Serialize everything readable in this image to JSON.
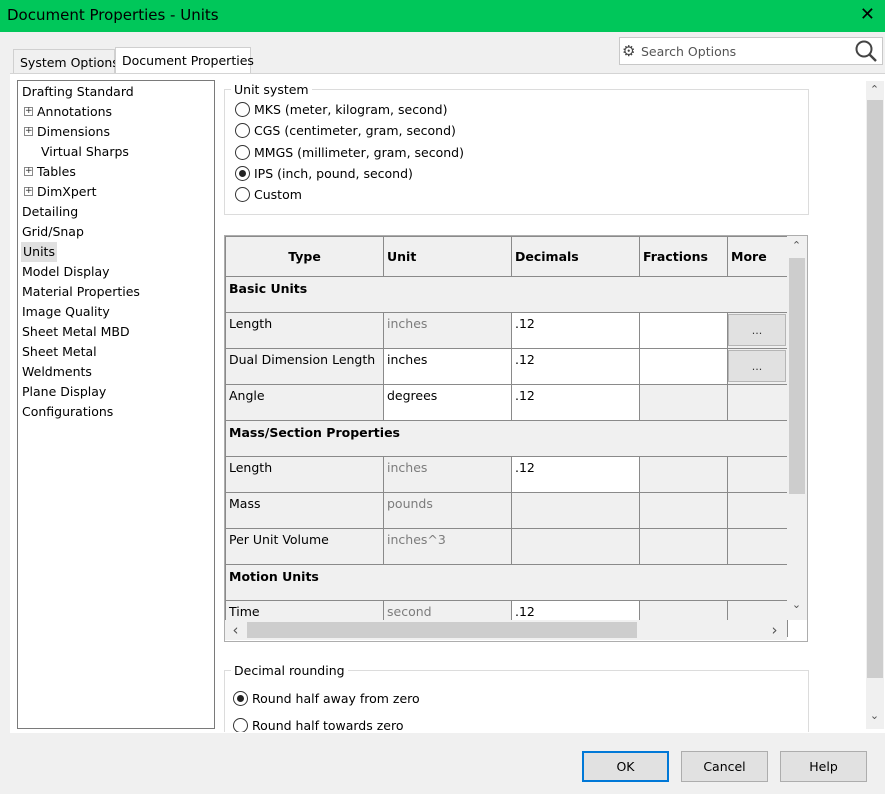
{
  "window": {
    "title": "Document Properties - Units",
    "close_glyph": "✕"
  },
  "tabs": [
    {
      "label": "System Options"
    },
    {
      "label": "Document Properties"
    }
  ],
  "search": {
    "placeholder": "Search Options",
    "gear_icon": "⚙"
  },
  "tree": [
    {
      "label": "Drafting Standard"
    },
    {
      "label": "Annotations",
      "expand": "+"
    },
    {
      "label": "Dimensions",
      "expand": "+"
    },
    {
      "label": "Virtual Sharps"
    },
    {
      "label": "Tables",
      "expand": "+"
    },
    {
      "label": "DimXpert",
      "expand": "+"
    },
    {
      "label": "Detailing"
    },
    {
      "label": "Grid/Snap"
    },
    {
      "label": "Units"
    },
    {
      "label": "Model Display"
    },
    {
      "label": "Material Properties"
    },
    {
      "label": "Image Quality"
    },
    {
      "label": "Sheet Metal MBD"
    },
    {
      "label": "Sheet Metal"
    },
    {
      "label": "Weldments"
    },
    {
      "label": "Plane Display"
    },
    {
      "label": "Configurations"
    }
  ],
  "unit_system": {
    "legend": "Unit system",
    "options": [
      {
        "label": "MKS  (meter, kilogram, second)"
      },
      {
        "label": "CGS  (centimeter, gram, second)"
      },
      {
        "label": "MMGS (millimeter, gram, second)"
      },
      {
        "label": "IPS  (inch, pound, second)"
      },
      {
        "label": "Custom"
      }
    ],
    "selected": "IPS  (inch, pound, second)"
  },
  "grid": {
    "headers": {
      "type": "Type",
      "unit": "Unit",
      "decimals": "Decimals",
      "fractions": "Fractions",
      "more": "More"
    },
    "more_button": "...",
    "sections": {
      "basic": "Basic Units",
      "mass": "Mass/Section Properties",
      "motion": "Motion Units"
    },
    "rows": {
      "basic_length": {
        "type": "Length",
        "unit": "inches",
        "decimals": ".12"
      },
      "dual_length": {
        "type": "Dual Dimension Length",
        "unit": "inches",
        "decimals": ".12"
      },
      "angle": {
        "type": "Angle",
        "unit": "degrees",
        "decimals": ".12"
      },
      "mass_length": {
        "type": "Length",
        "unit": "inches",
        "decimals": ".12"
      },
      "mass": {
        "type": "Mass",
        "unit": "pounds"
      },
      "volume": {
        "type": "Per Unit Volume",
        "unit": "inches^3"
      },
      "time": {
        "type": "Time",
        "unit": "second",
        "decimals": ".12"
      }
    },
    "scroll_up": "⌃",
    "scroll_down": "⌄",
    "scroll_left": "‹",
    "scroll_right": "›"
  },
  "decimal_rounding": {
    "legend": "Decimal rounding",
    "options": [
      {
        "label": "Round half away from zero"
      },
      {
        "label": "Round half towards zero"
      }
    ],
    "selected": "Round half away from zero"
  },
  "buttons": {
    "ok": "OK",
    "cancel": "Cancel",
    "help": "Help"
  },
  "colors": {
    "titlebar": "#00c75a",
    "focus": "#0078d7"
  }
}
